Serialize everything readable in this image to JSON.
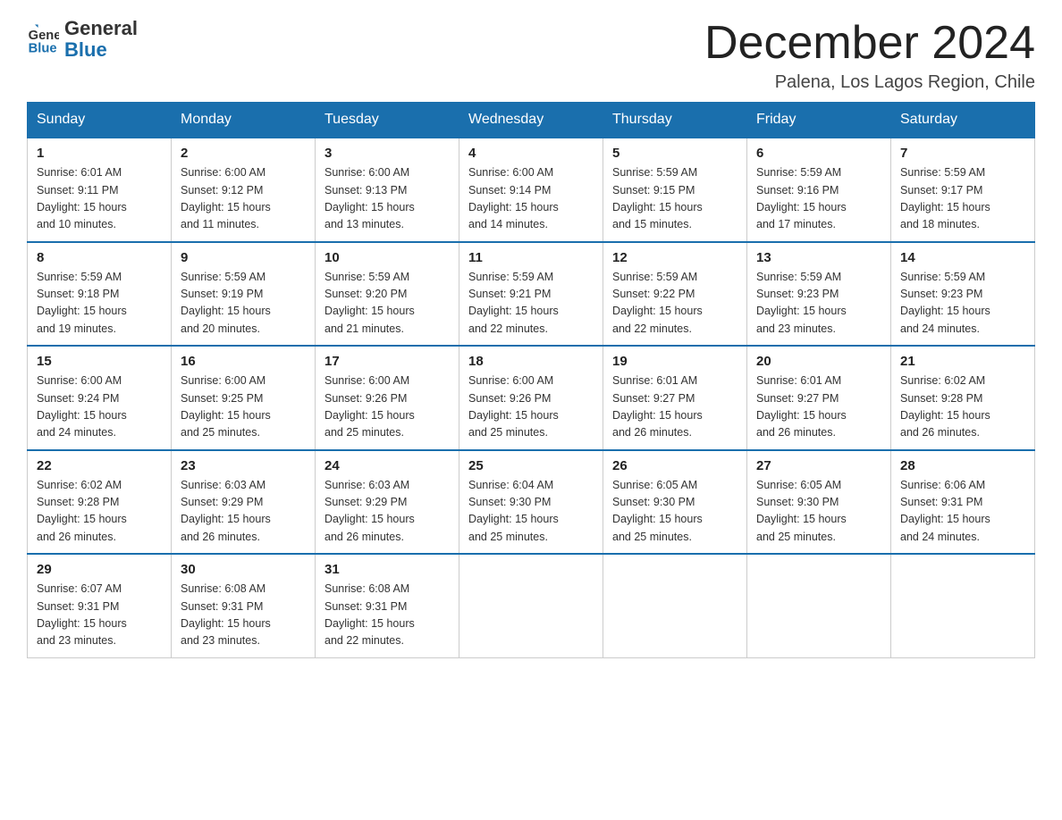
{
  "header": {
    "logo_line1": "General",
    "logo_line2": "Blue",
    "main_title": "December 2024",
    "subtitle": "Palena, Los Lagos Region, Chile"
  },
  "days_of_week": [
    "Sunday",
    "Monday",
    "Tuesday",
    "Wednesday",
    "Thursday",
    "Friday",
    "Saturday"
  ],
  "weeks": [
    [
      {
        "day": "1",
        "sunrise": "6:01 AM",
        "sunset": "9:11 PM",
        "daylight": "15 hours and 10 minutes."
      },
      {
        "day": "2",
        "sunrise": "6:00 AM",
        "sunset": "9:12 PM",
        "daylight": "15 hours and 11 minutes."
      },
      {
        "day": "3",
        "sunrise": "6:00 AM",
        "sunset": "9:13 PM",
        "daylight": "15 hours and 13 minutes."
      },
      {
        "day": "4",
        "sunrise": "6:00 AM",
        "sunset": "9:14 PM",
        "daylight": "15 hours and 14 minutes."
      },
      {
        "day": "5",
        "sunrise": "5:59 AM",
        "sunset": "9:15 PM",
        "daylight": "15 hours and 15 minutes."
      },
      {
        "day": "6",
        "sunrise": "5:59 AM",
        "sunset": "9:16 PM",
        "daylight": "15 hours and 17 minutes."
      },
      {
        "day": "7",
        "sunrise": "5:59 AM",
        "sunset": "9:17 PM",
        "daylight": "15 hours and 18 minutes."
      }
    ],
    [
      {
        "day": "8",
        "sunrise": "5:59 AM",
        "sunset": "9:18 PM",
        "daylight": "15 hours and 19 minutes."
      },
      {
        "day": "9",
        "sunrise": "5:59 AM",
        "sunset": "9:19 PM",
        "daylight": "15 hours and 20 minutes."
      },
      {
        "day": "10",
        "sunrise": "5:59 AM",
        "sunset": "9:20 PM",
        "daylight": "15 hours and 21 minutes."
      },
      {
        "day": "11",
        "sunrise": "5:59 AM",
        "sunset": "9:21 PM",
        "daylight": "15 hours and 22 minutes."
      },
      {
        "day": "12",
        "sunrise": "5:59 AM",
        "sunset": "9:22 PM",
        "daylight": "15 hours and 22 minutes."
      },
      {
        "day": "13",
        "sunrise": "5:59 AM",
        "sunset": "9:23 PM",
        "daylight": "15 hours and 23 minutes."
      },
      {
        "day": "14",
        "sunrise": "5:59 AM",
        "sunset": "9:23 PM",
        "daylight": "15 hours and 24 minutes."
      }
    ],
    [
      {
        "day": "15",
        "sunrise": "6:00 AM",
        "sunset": "9:24 PM",
        "daylight": "15 hours and 24 minutes."
      },
      {
        "day": "16",
        "sunrise": "6:00 AM",
        "sunset": "9:25 PM",
        "daylight": "15 hours and 25 minutes."
      },
      {
        "day": "17",
        "sunrise": "6:00 AM",
        "sunset": "9:26 PM",
        "daylight": "15 hours and 25 minutes."
      },
      {
        "day": "18",
        "sunrise": "6:00 AM",
        "sunset": "9:26 PM",
        "daylight": "15 hours and 25 minutes."
      },
      {
        "day": "19",
        "sunrise": "6:01 AM",
        "sunset": "9:27 PM",
        "daylight": "15 hours and 26 minutes."
      },
      {
        "day": "20",
        "sunrise": "6:01 AM",
        "sunset": "9:27 PM",
        "daylight": "15 hours and 26 minutes."
      },
      {
        "day": "21",
        "sunrise": "6:02 AM",
        "sunset": "9:28 PM",
        "daylight": "15 hours and 26 minutes."
      }
    ],
    [
      {
        "day": "22",
        "sunrise": "6:02 AM",
        "sunset": "9:28 PM",
        "daylight": "15 hours and 26 minutes."
      },
      {
        "day": "23",
        "sunrise": "6:03 AM",
        "sunset": "9:29 PM",
        "daylight": "15 hours and 26 minutes."
      },
      {
        "day": "24",
        "sunrise": "6:03 AM",
        "sunset": "9:29 PM",
        "daylight": "15 hours and 26 minutes."
      },
      {
        "day": "25",
        "sunrise": "6:04 AM",
        "sunset": "9:30 PM",
        "daylight": "15 hours and 25 minutes."
      },
      {
        "day": "26",
        "sunrise": "6:05 AM",
        "sunset": "9:30 PM",
        "daylight": "15 hours and 25 minutes."
      },
      {
        "day": "27",
        "sunrise": "6:05 AM",
        "sunset": "9:30 PM",
        "daylight": "15 hours and 25 minutes."
      },
      {
        "day": "28",
        "sunrise": "6:06 AM",
        "sunset": "9:31 PM",
        "daylight": "15 hours and 24 minutes."
      }
    ],
    [
      {
        "day": "29",
        "sunrise": "6:07 AM",
        "sunset": "9:31 PM",
        "daylight": "15 hours and 23 minutes."
      },
      {
        "day": "30",
        "sunrise": "6:08 AM",
        "sunset": "9:31 PM",
        "daylight": "15 hours and 23 minutes."
      },
      {
        "day": "31",
        "sunrise": "6:08 AM",
        "sunset": "9:31 PM",
        "daylight": "15 hours and 22 minutes."
      },
      null,
      null,
      null,
      null
    ]
  ],
  "sunrise_label": "Sunrise:",
  "sunset_label": "Sunset:",
  "daylight_label": "Daylight:"
}
